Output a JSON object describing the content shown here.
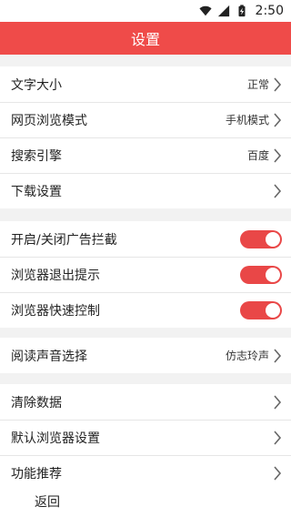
{
  "status_bar": {
    "time": "2:50"
  },
  "title": "设置",
  "groups": [
    {
      "items": [
        {
          "label": "文字大小",
          "value": "正常"
        },
        {
          "label": "网页浏览模式",
          "value": "手机模式"
        },
        {
          "label": "搜索引擎",
          "value": "百度"
        },
        {
          "label": "下载设置",
          "value": ""
        }
      ]
    },
    {
      "items": [
        {
          "label": "开启/关闭广告拦截",
          "toggle": "on"
        },
        {
          "label": "浏览器退出提示",
          "toggle": "on"
        },
        {
          "label": "浏览器快速控制",
          "toggle": "on"
        }
      ]
    },
    {
      "items": [
        {
          "label": "阅读声音选择",
          "value": "仿志玲声"
        }
      ]
    },
    {
      "items": [
        {
          "label": "清除数据"
        },
        {
          "label": "默认浏览器设置"
        },
        {
          "label": "功能推荐"
        }
      ]
    }
  ],
  "footer": {
    "back_label": "返回"
  },
  "colors": {
    "accent": "#ef4b49",
    "toggle_on": "#e94747",
    "background": "#f2f2f2"
  }
}
